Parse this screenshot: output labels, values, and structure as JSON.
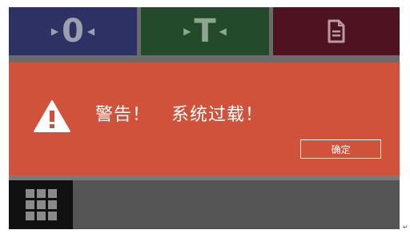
{
  "topbar": {
    "zero_label": "0",
    "tare_label": "T",
    "zero_color": "#2d3163",
    "tare_color": "#234a2a",
    "doc_color": "#4f1221",
    "doc_icon": "document-icon"
  },
  "alert": {
    "title": "警告！",
    "message": "系统过载！",
    "ok_label": "确定",
    "icon": "warning-icon",
    "background": "#d0523a"
  },
  "bottombar": {
    "menu_icon": "grid-menu-icon"
  },
  "page_mark": "↵"
}
